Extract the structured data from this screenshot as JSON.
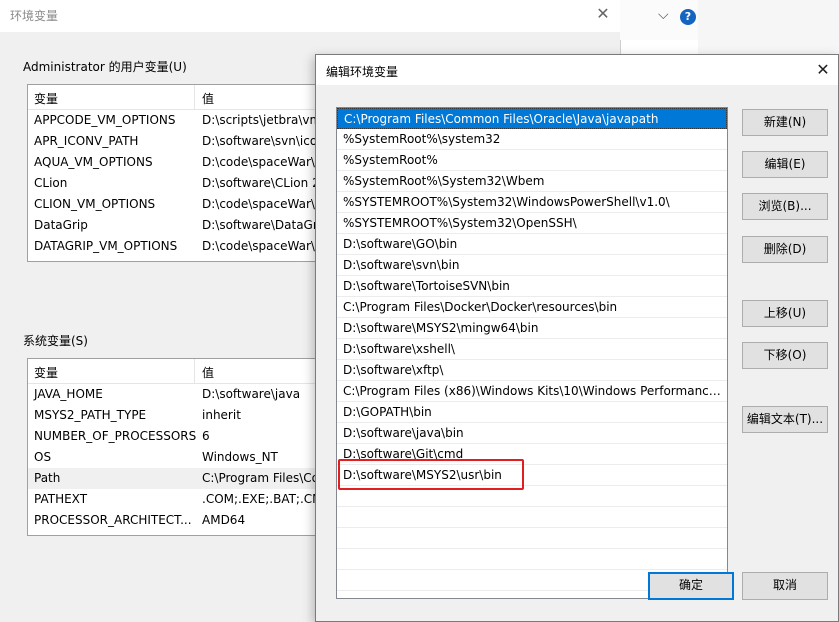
{
  "background_window": {
    "title": "环境变量",
    "user_group_label": "Administrator 的用户变量(U)",
    "system_group_label": "系统变量(S)",
    "columns": [
      "变量",
      "值"
    ],
    "user_vars": [
      {
        "name": "APPCODE_VM_OPTIONS",
        "value": "D:\\scripts\\jetbra\\vm"
      },
      {
        "name": "APR_ICONV_PATH",
        "value": "D:\\software\\svn\\ico"
      },
      {
        "name": "AQUA_VM_OPTIONS",
        "value": "D:\\code\\spaceWar\\"
      },
      {
        "name": "CLion",
        "value": "D:\\software\\CLion 2"
      },
      {
        "name": "CLION_VM_OPTIONS",
        "value": "D:\\code\\spaceWar\\"
      },
      {
        "name": "DataGrip",
        "value": "D:\\software\\DataGri"
      },
      {
        "name": "DATAGRIP_VM_OPTIONS",
        "value": "D:\\code\\spaceWar\\"
      }
    ],
    "system_vars": [
      {
        "name": "JAVA_HOME",
        "value": "D:\\software\\java"
      },
      {
        "name": "MSYS2_PATH_TYPE",
        "value": "inherit"
      },
      {
        "name": "NUMBER_OF_PROCESSORS",
        "value": "6"
      },
      {
        "name": "OS",
        "value": "Windows_NT"
      },
      {
        "name": "Path",
        "value": "C:\\Program Files\\Co"
      },
      {
        "name": "PATHEXT",
        "value": ".COM;.EXE;.BAT;.CM"
      },
      {
        "name": "PROCESSOR_ARCHITECT...",
        "value": "AMD64"
      }
    ]
  },
  "dialog": {
    "title": "编辑环境变量",
    "paths": [
      "C:\\Program Files\\Common Files\\Oracle\\Java\\javapath",
      "%SystemRoot%\\system32",
      "%SystemRoot%",
      "%SystemRoot%\\System32\\Wbem",
      "%SYSTEMROOT%\\System32\\WindowsPowerShell\\v1.0\\",
      "%SYSTEMROOT%\\System32\\OpenSSH\\",
      "D:\\software\\GO\\bin",
      "D:\\software\\svn\\bin",
      "D:\\software\\TortoiseSVN\\bin",
      "C:\\Program Files\\Docker\\Docker\\resources\\bin",
      "D:\\software\\MSYS2\\mingw64\\bin",
      "D:\\software\\xshell\\",
      "D:\\software\\xftp\\",
      "C:\\Program Files (x86)\\Windows Kits\\10\\Windows Performance ...",
      "D:\\GOPATH\\bin",
      "D:\\software\\java\\bin",
      "D:\\software\\Git\\cmd",
      "D:\\software\\MSYS2\\usr\\bin"
    ],
    "buttons": {
      "new": "新建(N)",
      "edit": "编辑(E)",
      "browse": "浏览(B)...",
      "delete": "删除(D)",
      "move_up": "上移(U)",
      "move_down": "下移(O)",
      "edit_text": "编辑文本(T)...",
      "ok": "确定",
      "cancel": "取消"
    },
    "highlight_color": "#e02020",
    "selection_color": "#0078d7"
  }
}
